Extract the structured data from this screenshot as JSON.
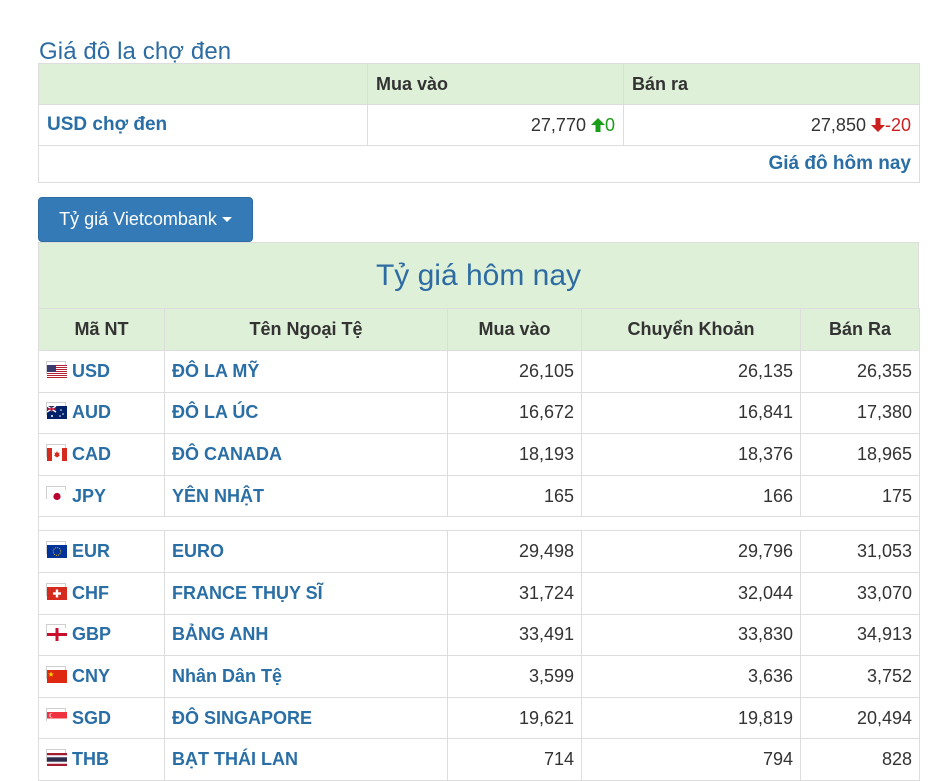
{
  "page": {
    "title": "Giá đô la chợ đen"
  },
  "black_market": {
    "headers": {
      "empty": "",
      "buy": "Mua vào",
      "sell": "Bán ra"
    },
    "row": {
      "name": "USD chợ đen",
      "buy": "27,770",
      "buy_change": "0",
      "buy_trend": "up",
      "sell": "27,850",
      "sell_change": "-20",
      "sell_trend": "down"
    },
    "link": "Giá đô hôm nay"
  },
  "dropdown": {
    "label": "Tỷ giá Vietcombank"
  },
  "rates": {
    "title": "Tỷ giá hôm nay",
    "headers": {
      "code": "Mã NT",
      "name": "Tên Ngoại Tệ",
      "buy": "Mua vào",
      "transfer": "Chuyển Khoản",
      "sell": "Bán Ra"
    },
    "rows": [
      {
        "code": "USD",
        "name": "ĐÔ LA MỸ",
        "buy": "26,105",
        "transfer": "26,135",
        "sell": "26,355",
        "flag": "us-flag-icon"
      },
      {
        "code": "AUD",
        "name": "ĐÔ LA ÚC",
        "buy": "16,672",
        "transfer": "16,841",
        "sell": "17,380",
        "flag": "au-flag-icon"
      },
      {
        "code": "CAD",
        "name": "ĐÔ CANADA",
        "buy": "18,193",
        "transfer": "18,376",
        "sell": "18,965",
        "flag": "ca-flag-icon"
      },
      {
        "code": "JPY",
        "name": "YÊN NHẬT",
        "buy": "165",
        "transfer": "166",
        "sell": "175",
        "flag": "jp-flag-icon"
      },
      {
        "code": "EUR",
        "name": "EURO",
        "buy": "29,498",
        "transfer": "29,796",
        "sell": "31,053",
        "flag": "eu-flag-icon"
      },
      {
        "code": "CHF",
        "name": "FRANCE THỤY SĨ",
        "buy": "31,724",
        "transfer": "32,044",
        "sell": "33,070",
        "flag": "ch-flag-icon"
      },
      {
        "code": "GBP",
        "name": "BẢNG ANH",
        "buy": "33,491",
        "transfer": "33,830",
        "sell": "34,913",
        "flag": "gb-flag-icon"
      },
      {
        "code": "CNY",
        "name": "Nhân Dân Tệ",
        "buy": "3,599",
        "transfer": "3,636",
        "sell": "3,752",
        "flag": "cn-flag-icon"
      },
      {
        "code": "SGD",
        "name": "ĐÔ SINGAPORE",
        "buy": "19,621",
        "transfer": "19,819",
        "sell": "20,494",
        "flag": "sg-flag-icon"
      },
      {
        "code": "THB",
        "name": "BẠT THÁI LAN",
        "buy": "714",
        "transfer": "794",
        "sell": "828",
        "flag": "th-flag-icon"
      }
    ]
  },
  "colors": {
    "header_bg": "#dff0d8",
    "link": "#2a6ea6",
    "button": "#337ab7",
    "up": "#1a9e1a",
    "down": "#cc1f1f"
  }
}
